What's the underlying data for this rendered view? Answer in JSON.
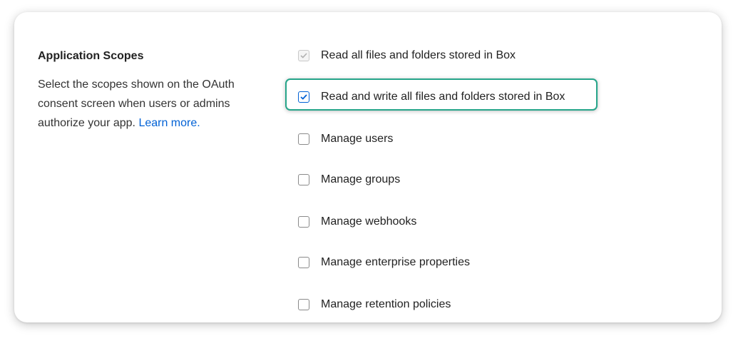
{
  "section": {
    "title": "Application Scopes",
    "description": "Select the scopes shown on the OAuth consent screen when users or admins authorize your app.",
    "learn_more": "Learn more."
  },
  "scopes": [
    {
      "label": "Read all files and folders stored in Box",
      "checked": true,
      "disabled": true
    },
    {
      "label": "Read and write all files and folders stored in Box",
      "checked": true,
      "disabled": false,
      "highlighted": true
    },
    {
      "label": "Manage users",
      "checked": false,
      "disabled": false
    },
    {
      "label": "Manage groups",
      "checked": false,
      "disabled": false
    },
    {
      "label": "Manage webhooks",
      "checked": false,
      "disabled": false
    },
    {
      "label": "Manage enterprise properties",
      "checked": false,
      "disabled": false
    },
    {
      "label": "Manage retention policies",
      "checked": false,
      "disabled": false
    }
  ],
  "colors": {
    "accent": "#0061d5",
    "highlight_border": "#26a58a"
  }
}
